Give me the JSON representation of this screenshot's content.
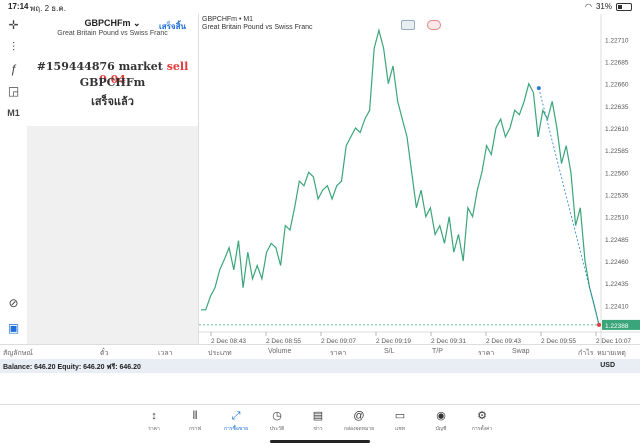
{
  "status_bar": {
    "time": "17:14",
    "date": "พฤ. 2 ธ.ค.",
    "battery": "31%"
  },
  "toolbar": {
    "crosshair_icon": "crosshair-icon",
    "indicator_icon": "candles-icon",
    "function_icon": "function-icon",
    "objects_icon": "shapes-icon",
    "timeframe": "M1"
  },
  "order_panel": {
    "symbol": "GBPCHFm",
    "description": "Great Britain Pound vs Swiss Franc",
    "done_label": "เสร็จสิ้น",
    "order_prefix": "#159444876 market",
    "order_sell": "sell 0.04",
    "order_symbol": "GBPCHFm",
    "order_status": "เสร็จแล้ว"
  },
  "chart": {
    "title": "GBPCHFm • M1",
    "subtitle": "Great Britain Pound vs Swiss Franc",
    "current_price_label": "1.22388",
    "colors": {
      "line": "#3aa57a",
      "price_line": "#3aa57a",
      "trade_line": "#2a7fd4",
      "sell_marker": "#e03a3a"
    }
  },
  "chart_data": {
    "type": "line",
    "x_ticks": [
      "2 Dec 08:43",
      "2 Dec 08:55",
      "2 Dec 09:07",
      "2 Dec 09:19",
      "2 Dec 09:31",
      "2 Dec 09:43",
      "2 Dec 09:55",
      "2 Dec 10:07"
    ],
    "y_ticks": [
      "1.22710",
      "1.22685",
      "1.22660",
      "1.22635",
      "1.22610",
      "1.22585",
      "1.22560",
      "1.22535",
      "1.22510",
      "1.22485",
      "1.22460",
      "1.22435",
      "1.22410",
      "1.22388"
    ],
    "ylim": [
      1.2238,
      1.22725
    ],
    "series": [
      {
        "values": [
          1.22405,
          1.22405,
          1.2242,
          1.2243,
          1.2245,
          1.22462,
          1.22475,
          1.2245,
          1.22483,
          1.2243,
          1.2247,
          1.2244,
          1.22455,
          1.2244,
          1.2247,
          1.2248,
          1.22475,
          1.22455,
          1.225,
          1.22495,
          1.2252,
          1.2255,
          1.22545,
          1.2256,
          1.22555,
          1.2253,
          1.2254,
          1.22545,
          1.2253,
          1.22545,
          1.2255,
          1.2259,
          1.226,
          1.2261,
          1.22605,
          1.2262,
          1.2263,
          1.227,
          1.2272,
          1.227,
          1.2266,
          1.2268,
          1.2264,
          1.2262,
          1.226,
          1.2256,
          1.2252,
          1.2254,
          1.2251,
          1.2252,
          1.2249,
          1.225,
          1.2248,
          1.2251,
          1.2247,
          1.2249,
          1.2246,
          1.2252,
          1.2251,
          1.2254,
          1.2256,
          1.2259,
          1.2258,
          1.2261,
          1.2262,
          1.226,
          1.2261,
          1.2263,
          1.22625,
          1.2264,
          1.2266,
          1.2265,
          1.226,
          1.2263,
          1.2262,
          1.2264,
          1.2261,
          1.2257,
          1.2259,
          1.2256,
          1.225,
          1.2252,
          1.2246,
          1.2243,
          1.2241,
          1.22388
        ]
      }
    ],
    "trade": {
      "open_price": 1.22655,
      "close_price": 1.22388
    }
  },
  "positions_header": [
    "สัญลักษณ์",
    "ตั๋ว",
    "เวลา",
    "ประเภท",
    "Volume",
    "ราคา",
    "S/L",
    "T/P",
    "ราคา",
    "Swap",
    "กำไร",
    "หมายเหตุ"
  ],
  "balance": {
    "text": "Balance: 646.20 Equity: 646.20 ฟรี: 646.20",
    "currency": "USD"
  },
  "bottom_nav": [
    {
      "label": "ราคา",
      "icon": "quotes-icon",
      "glyph": "↕"
    },
    {
      "label": "กราฟ",
      "icon": "chart-icon",
      "glyph": "⫴"
    },
    {
      "label": "การซื้อขาย",
      "icon": "trade-icon",
      "glyph": "⤢",
      "active": true
    },
    {
      "label": "ประวัติ",
      "icon": "history-icon",
      "glyph": "◷"
    },
    {
      "label": "ข่าว",
      "icon": "news-icon",
      "glyph": "▤"
    },
    {
      "label": "กล่องจดหมาย",
      "icon": "mailbox-icon",
      "glyph": "@"
    },
    {
      "label": "แชท",
      "icon": "chat-icon",
      "glyph": "▭"
    },
    {
      "label": "บัญชี",
      "icon": "account-icon",
      "glyph": "◉"
    },
    {
      "label": "การตั้งค่า",
      "icon": "settings-icon",
      "glyph": "⚙"
    }
  ]
}
